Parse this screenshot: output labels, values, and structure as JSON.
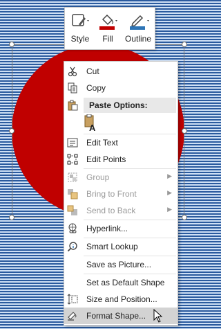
{
  "minibar": {
    "style_label": "Style",
    "fill_label": "Fill",
    "outline_label": "Outline"
  },
  "menu": {
    "cut": "Cut",
    "copy": "Copy",
    "paste_options": "Paste Options:",
    "edit_text": "Edit Text",
    "edit_points": "Edit Points",
    "group": "Group",
    "bring_to_front": "Bring to Front",
    "send_to_back": "Send to Back",
    "hyperlink": "Hyperlink...",
    "smart_lookup": "Smart Lookup",
    "save_as_picture": "Save as Picture...",
    "set_default_shape": "Set as Default Shape",
    "size_and_position": "Size and Position...",
    "format_shape": "Format Shape..."
  },
  "colors": {
    "shape_fill": "#c00000",
    "fill_swatch": "#c00000",
    "outline_swatch": "#2e75b6",
    "menu_highlight": "#d3d3d3"
  }
}
